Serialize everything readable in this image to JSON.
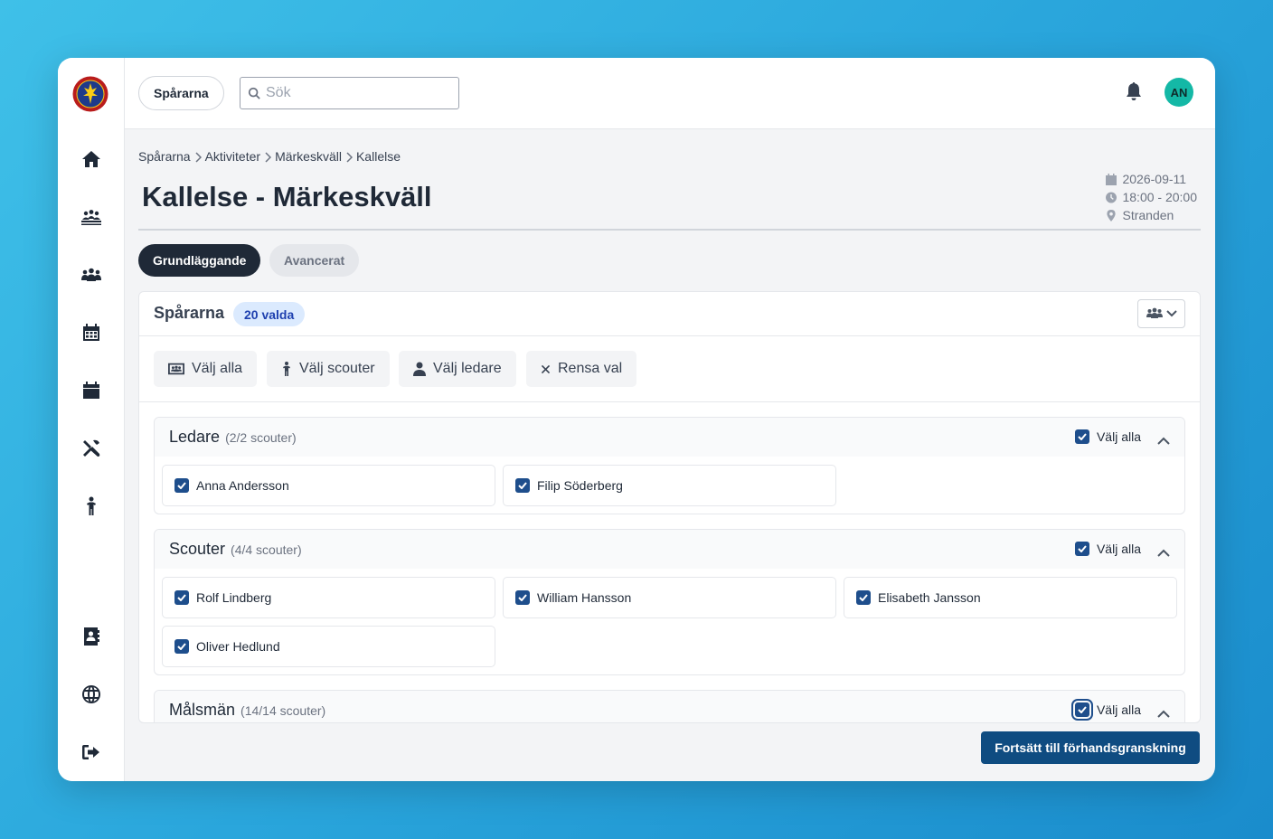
{
  "topbar": {
    "org_label": "Spårarna",
    "search_placeholder": "Sök",
    "user_initials": "AN"
  },
  "breadcrumb": [
    "Spårarna",
    "Aktiviteter",
    "Märkeskväll",
    "Kallelse"
  ],
  "page": {
    "title": "Kallelse - Märkeskväll",
    "date": "2026-09-11",
    "time": "18:00 - 20:00",
    "location": "Stranden"
  },
  "tabs": {
    "basic": "Grundläggande",
    "advanced": "Avancerat"
  },
  "card": {
    "title": "Spårarna",
    "selected_badge": "20 valda"
  },
  "actions": {
    "select_all": "Välj alla",
    "select_scouts": "Välj scouter",
    "select_leaders": "Välj ledare",
    "clear": "Rensa val"
  },
  "groups": [
    {
      "name": "Ledare",
      "count": "(2/2 scouter)",
      "select_all": "Välj alla",
      "members": [
        "Anna Andersson",
        "Filip Söderberg"
      ]
    },
    {
      "name": "Scouter",
      "count": "(4/4 scouter)",
      "select_all": "Välj alla",
      "members": [
        "Rolf Lindberg",
        "William Hansson",
        "Elisabeth Jansson",
        "Oliver Hedlund"
      ]
    },
    {
      "name": "Målsmän",
      "count": "(14/14 scouter)",
      "select_all": "Välj alla",
      "members": []
    }
  ],
  "footer": {
    "continue_label": "Fortsätt till förhandsgranskning"
  },
  "colors": {
    "primary": "#0f4c81",
    "checkbox": "#1e4e8c",
    "badge_bg": "#dbeafe",
    "avatar": "#14b8a6",
    "dark_tab": "#1f2937"
  }
}
